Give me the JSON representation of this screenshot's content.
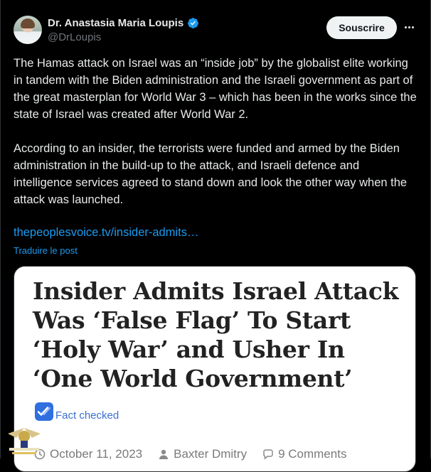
{
  "author": {
    "display_name": "Dr. Anastasia Maria Loupis",
    "handle": "@DrLoupis",
    "verified": true,
    "verified_color": "#1d9bf0"
  },
  "actions": {
    "subscribe_label": "Souscrire",
    "more_icon": "more-horizontal-icon"
  },
  "tweet": {
    "paragraphs": [
      "The Hamas attack on Israel was an “inside job” by the globalist elite working in tandem with the Biden administration and the Israeli government as part of the great masterplan for World War 3 – which has been in the works since the state of Israel was created after World War 2.",
      "According to an insider, the terrorists were funded and armed by the Biden administration in the build-up to the attack, and Israeli defence and intelligence services agreed to stand down and look the other way when the attack was launched."
    ],
    "link_text": "thepeoplesvoice.tv/insider-admits…",
    "translate_label": "Traduire le post"
  },
  "card": {
    "headline": "Insider Admits Israel Attack Was ‘False Flag’ To Start ‘Holy War’ and Usher In ‘One World Government’",
    "fact_checked_label": "Fact checked",
    "date": "October 11, 2023",
    "author": "Baxter Dmitry",
    "comments": "9 Comments"
  },
  "colors": {
    "background": "#000000",
    "text": "#e7e9ea",
    "secondary_text": "#71767b",
    "link": "#1d9bf0",
    "card_background": "#ffffff"
  }
}
